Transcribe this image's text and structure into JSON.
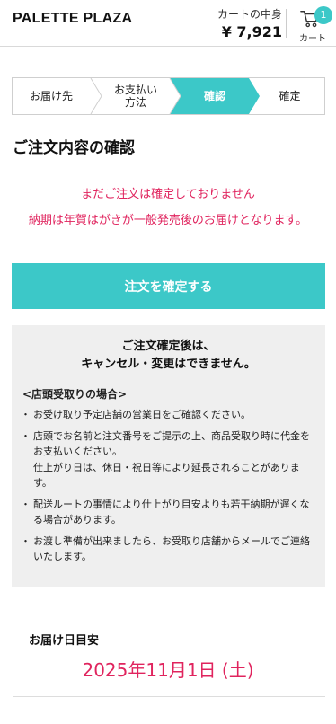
{
  "header": {
    "logo": "PALETTE PLAZA",
    "cart_label": "カートの中身",
    "cart_total": "¥ 7,921",
    "cart_badge": "1",
    "cart_button_label": "カート"
  },
  "steps": [
    {
      "label": "お届け先",
      "state": "done"
    },
    {
      "label": "お支払い\n方法",
      "state": "done"
    },
    {
      "label": "確認",
      "state": "active"
    },
    {
      "label": "確定",
      "state": "pending"
    }
  ],
  "page_title": "ご注文内容の確認",
  "warnings": {
    "not_confirmed": "まだご注文は確定しておりません",
    "delivery_note": "納期は年賀はがきが一般発売後のお届けとなります。"
  },
  "confirm_button": "注文を確定する",
  "notice": {
    "head_line1": "ご注文確定後は、",
    "head_line2": "キャンセル・変更はできません。",
    "subtitle": "<店頭受取りの場合>",
    "items": [
      "お受け取り予定店舗の営業日をご確認ください。",
      "店頭でお名前と注文番号をご提示の上、商品受取り時に代金をお支払いください。",
      "仕上がり日は、休日・祝日等により延長されることがあります。",
      "配送ルートの事情により仕上がり目安よりも若干納期が遅くなる場合があります。",
      "お渡し準備が出来ましたら、お受取り店舗からメールでご連絡いたします。"
    ]
  },
  "delivery": {
    "label": "お届け日目安",
    "date": "2025年11月1日 (土)"
  },
  "colors": {
    "accent": "#3cc8c8",
    "warning": "#e0245e",
    "notice_bg": "#efefef"
  }
}
